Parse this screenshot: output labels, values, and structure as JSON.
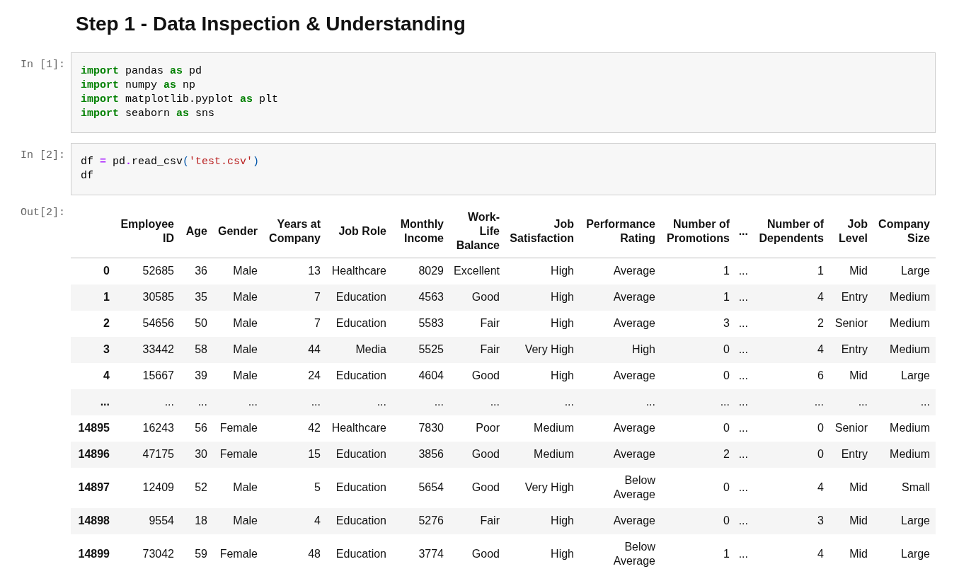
{
  "heading": "Step 1 - Data Inspection & Understanding",
  "cells": [
    {
      "prompt": "In [1]:",
      "lines": [
        [
          {
            "kind": "keyword",
            "text": "import"
          },
          {
            "kind": "name",
            "text": " pandas "
          },
          {
            "kind": "keyword",
            "text": "as"
          },
          {
            "kind": "name",
            "text": " pd"
          }
        ],
        [
          {
            "kind": "keyword",
            "text": "import"
          },
          {
            "kind": "name",
            "text": " numpy "
          },
          {
            "kind": "keyword",
            "text": "as"
          },
          {
            "kind": "name",
            "text": " np"
          }
        ],
        [
          {
            "kind": "keyword",
            "text": "import"
          },
          {
            "kind": "name",
            "text": " matplotlib.pyplot "
          },
          {
            "kind": "keyword",
            "text": "as"
          },
          {
            "kind": "name",
            "text": " plt"
          }
        ],
        [
          {
            "kind": "keyword",
            "text": "import"
          },
          {
            "kind": "name",
            "text": " seaborn "
          },
          {
            "kind": "keyword",
            "text": "as"
          },
          {
            "kind": "name",
            "text": " sns"
          }
        ]
      ]
    },
    {
      "prompt": "In [2]:",
      "lines": [
        [
          {
            "kind": "name",
            "text": "df "
          },
          {
            "kind": "operator",
            "text": "="
          },
          {
            "kind": "name",
            "text": " pd"
          },
          {
            "kind": "operator",
            "text": "."
          },
          {
            "kind": "name",
            "text": "read_csv"
          },
          {
            "kind": "punctuation",
            "text": "("
          },
          {
            "kind": "string",
            "text": "'test.csv'"
          },
          {
            "kind": "punctuation",
            "text": ")"
          }
        ],
        [
          {
            "kind": "name",
            "text": "df"
          }
        ]
      ]
    }
  ],
  "output": {
    "prompt": "Out[2]:",
    "table": {
      "columns": [
        "Employee ID",
        "Age",
        "Gender",
        "Years at Company",
        "Job Role",
        "Monthly Income",
        "Work-Life Balance",
        "Job Satisfaction",
        "Performance Rating",
        "Number of Promotions",
        "...",
        "Number of Dependents",
        "Job Level",
        "Company Size"
      ],
      "rows": [
        {
          "index": "0",
          "cells": [
            "52685",
            "36",
            "Male",
            "13",
            "Healthcare",
            "8029",
            "Excellent",
            "High",
            "Average",
            "1",
            "...",
            "1",
            "Mid",
            "Large"
          ]
        },
        {
          "index": "1",
          "cells": [
            "30585",
            "35",
            "Male",
            "7",
            "Education",
            "4563",
            "Good",
            "High",
            "Average",
            "1",
            "...",
            "4",
            "Entry",
            "Medium"
          ]
        },
        {
          "index": "2",
          "cells": [
            "54656",
            "50",
            "Male",
            "7",
            "Education",
            "5583",
            "Fair",
            "High",
            "Average",
            "3",
            "...",
            "2",
            "Senior",
            "Medium"
          ]
        },
        {
          "index": "3",
          "cells": [
            "33442",
            "58",
            "Male",
            "44",
            "Media",
            "5525",
            "Fair",
            "Very High",
            "High",
            "0",
            "...",
            "4",
            "Entry",
            "Medium"
          ]
        },
        {
          "index": "4",
          "cells": [
            "15667",
            "39",
            "Male",
            "24",
            "Education",
            "4604",
            "Good",
            "High",
            "Average",
            "0",
            "...",
            "6",
            "Mid",
            "Large"
          ]
        },
        {
          "index": "...",
          "cells": [
            "...",
            "...",
            "...",
            "...",
            "...",
            "...",
            "...",
            "...",
            "...",
            "...",
            "...",
            "...",
            "...",
            "..."
          ]
        },
        {
          "index": "14895",
          "cells": [
            "16243",
            "56",
            "Female",
            "42",
            "Healthcare",
            "7830",
            "Poor",
            "Medium",
            "Average",
            "0",
            "...",
            "0",
            "Senior",
            "Medium"
          ]
        },
        {
          "index": "14896",
          "cells": [
            "47175",
            "30",
            "Female",
            "15",
            "Education",
            "3856",
            "Good",
            "Medium",
            "Average",
            "2",
            "...",
            "0",
            "Entry",
            "Medium"
          ]
        },
        {
          "index": "14897",
          "cells": [
            "12409",
            "52",
            "Male",
            "5",
            "Education",
            "5654",
            "Good",
            "Very High",
            "Below Average",
            "0",
            "...",
            "4",
            "Mid",
            "Small"
          ]
        },
        {
          "index": "14898",
          "cells": [
            "9554",
            "18",
            "Male",
            "4",
            "Education",
            "5276",
            "Fair",
            "High",
            "Average",
            "0",
            "...",
            "3",
            "Mid",
            "Large"
          ]
        },
        {
          "index": "14899",
          "cells": [
            "73042",
            "59",
            "Female",
            "48",
            "Education",
            "3774",
            "Good",
            "High",
            "Below Average",
            "1",
            "...",
            "4",
            "Mid",
            "Large"
          ]
        }
      ]
    }
  }
}
